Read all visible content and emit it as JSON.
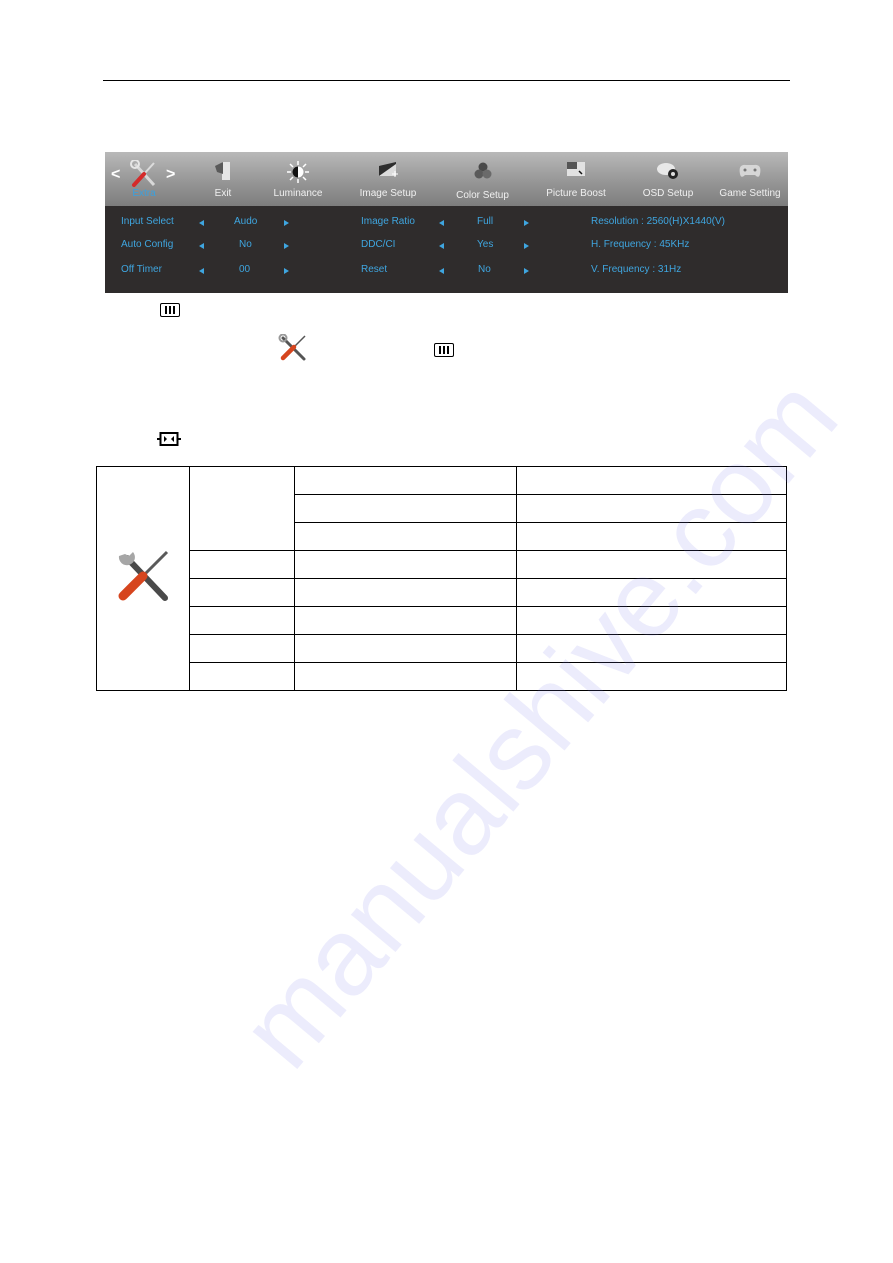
{
  "osd": {
    "nav_prev": "<",
    "nav_next": ">",
    "tabs": [
      {
        "label": "Extra",
        "icon": "tools-icon",
        "active": true
      },
      {
        "label": "Exit",
        "icon": "exit-icon",
        "active": false
      },
      {
        "label": "Luminance",
        "icon": "sun-icon",
        "active": false
      },
      {
        "label": "Image Setup",
        "icon": "image-setup-icon",
        "active": false
      },
      {
        "label": "Color Setup",
        "icon": "color-circles-icon",
        "active": false
      },
      {
        "label": "Picture Boost",
        "icon": "picture-boost-icon",
        "active": false
      },
      {
        "label": "OSD Setup",
        "icon": "osd-setup-icon",
        "active": false
      },
      {
        "label": "Game Setting",
        "icon": "gamepad-icon",
        "active": false
      }
    ],
    "settings_left": [
      {
        "label": "Input Select",
        "value": "Audo"
      },
      {
        "label": "Auto Config",
        "value": "No"
      },
      {
        "label": "Off Timer",
        "value": "00"
      }
    ],
    "settings_mid": [
      {
        "label": "Image Ratio",
        "value": "Full"
      },
      {
        "label": "DDC/CI",
        "value": "Yes"
      },
      {
        "label": "Reset",
        "value": "No"
      }
    ],
    "info": [
      "Resolution : 2560(H)X1440(V)",
      "H. Frequency : 45KHz",
      "V. Frequency : 31Hz"
    ],
    "colors": {
      "accent": "#3fa6e0",
      "panel_bg": "#2f2c2c"
    }
  },
  "watermark": "manualshive.com"
}
